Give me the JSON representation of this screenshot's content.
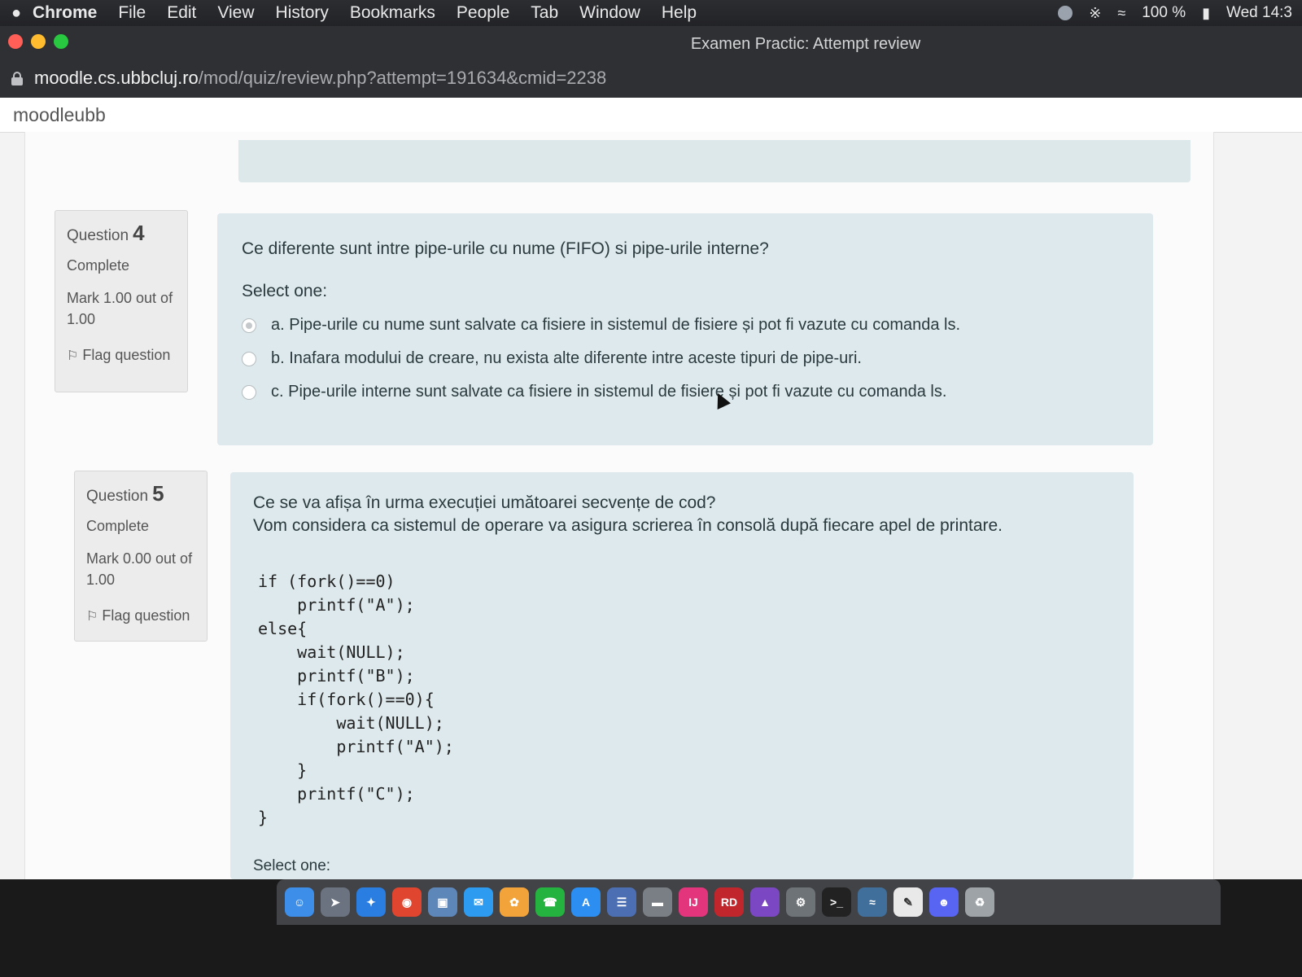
{
  "menubar": {
    "app_name": "Chrome",
    "items": [
      "File",
      "Edit",
      "View",
      "History",
      "Bookmarks",
      "People",
      "Tab",
      "Window",
      "Help"
    ],
    "battery": "100 %",
    "clock": "Wed 14:3"
  },
  "window": {
    "title": "Examen Practic: Attempt review",
    "url_host": "moodle.cs.ubbcluj.ro",
    "url_path": "/mod/quiz/review.php?attempt=191634&cmid=2238"
  },
  "site": {
    "brand": "moodleubb"
  },
  "questions": [
    {
      "label": "Question",
      "number": "4",
      "state": "Complete",
      "grade": "Mark 1.00 out of 1.00",
      "flag": "Flag question",
      "text": "Ce diferente sunt intre pipe-urile cu nume (FIFO) si pipe-urile interne?",
      "prompt": "Select one:",
      "answers": [
        {
          "label": "a. Pipe-urile cu nume sunt salvate ca fisiere in sistemul de fisiere și pot fi vazute cu comanda ls.",
          "selected": true
        },
        {
          "label": "b. Inafara modului de creare, nu exista alte diferente intre aceste tipuri de pipe-uri.",
          "selected": false
        },
        {
          "label": "c. Pipe-urile interne sunt salvate ca fisiere in sistemul de fisiere și pot fi vazute cu comanda ls.",
          "selected": false
        }
      ]
    },
    {
      "label": "Question",
      "number": "5",
      "state": "Complete",
      "grade": "Mark 0.00 out of 1.00",
      "flag": "Flag question",
      "text_line1": "Ce se va afișa în urma execuției umătoarei secvențe de cod?",
      "text_line2": "Vom considera ca sistemul de operare va asigura scrierea în consolă după fiecare apel de printare.",
      "code": "if (fork()==0)\n    printf(\"A\");\nelse{\n    wait(NULL);\n    printf(\"B\");\n    if(fork()==0){\n        wait(NULL);\n        printf(\"A\");\n    }\n    printf(\"C\");\n}",
      "prompt": "Select one:"
    }
  ],
  "dock": [
    "finder-icon",
    "launchpad-icon",
    "safari-icon",
    "chrome-icon",
    "preview-icon",
    "messages-icon",
    "photos-icon",
    "whatsapp-icon",
    "appstore-icon",
    "calendar-icon",
    "notes-icon",
    "intellij-icon",
    "rider-icon",
    "visualstudio-icon",
    "settings-icon",
    "terminal-icon",
    "mysql-icon",
    "textedit-icon",
    "discord-icon",
    "trash-icon"
  ]
}
